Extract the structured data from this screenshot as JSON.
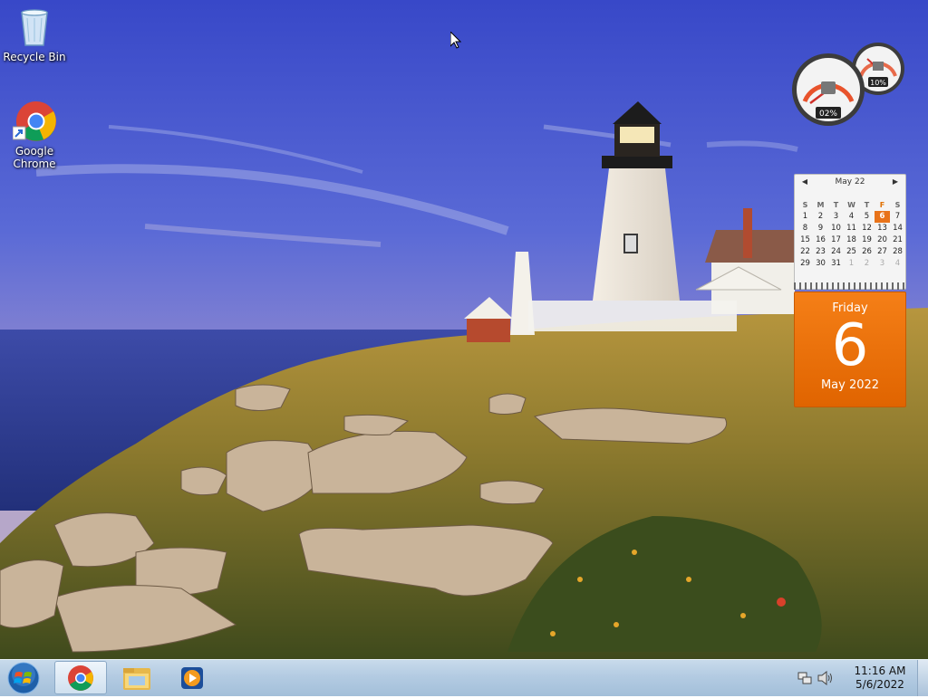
{
  "desktop": {
    "icons": [
      {
        "label": "Recycle Bin",
        "icon": "recycle-bin-icon"
      },
      {
        "label": "Google\nChrome",
        "icon": "chrome-icon"
      }
    ]
  },
  "gauge_gadget": {
    "cpu_label": "02%",
    "memory_label": "10%",
    "cpu_percent": 2,
    "memory_percent": 10
  },
  "calendar_gadget": {
    "month_label": "May 22",
    "weekdays": [
      "S",
      "M",
      "T",
      "W",
      "T",
      "F",
      "S"
    ],
    "weeks": [
      [
        "1",
        "2",
        "3",
        "4",
        "5",
        "6",
        "7"
      ],
      [
        "8",
        "9",
        "10",
        "11",
        "12",
        "13",
        "14"
      ],
      [
        "15",
        "16",
        "17",
        "18",
        "19",
        "20",
        "21"
      ],
      [
        "22",
        "23",
        "24",
        "25",
        "26",
        "27",
        "28"
      ],
      [
        "29",
        "30",
        "31",
        "1",
        "2",
        "3",
        "4"
      ]
    ],
    "today": "6",
    "weekday": "Friday",
    "day": "6",
    "month_year": "May 2022",
    "accent_color": "#e8731a"
  },
  "taskbar": {
    "pinned": [
      {
        "name": "chrome",
        "icon": "chrome-icon",
        "active": true
      },
      {
        "name": "windows-explorer",
        "icon": "folder-icon",
        "active": false
      },
      {
        "name": "windows-media-player",
        "icon": "media-player-icon",
        "active": false
      }
    ],
    "clock": {
      "time": "11:16 AM",
      "date": "5/6/2022"
    }
  },
  "colors": {
    "taskbar": "#b3cbe2",
    "sky": "#4a5ed0",
    "calendar_orange": "#f07a14"
  }
}
